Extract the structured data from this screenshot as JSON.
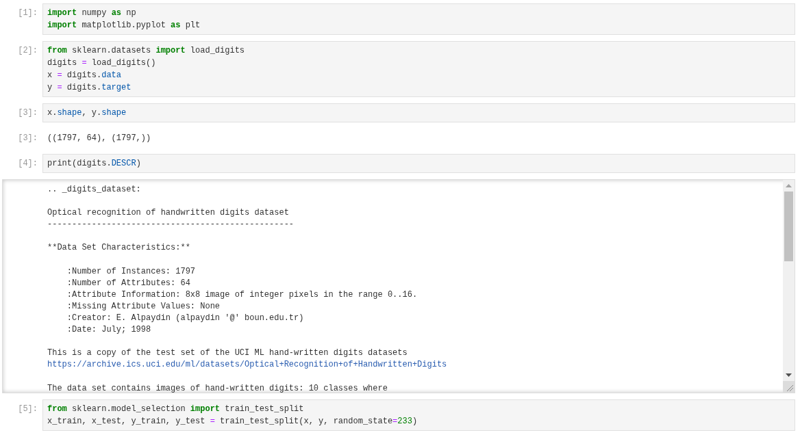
{
  "cells": [
    {
      "kind": "code",
      "prompt": "[1]:",
      "lines": [
        [
          {
            "kind": "kw",
            "text": "import"
          },
          {
            "kind": "plain",
            "text": " numpy "
          },
          {
            "kind": "kw",
            "text": "as"
          },
          {
            "kind": "plain",
            "text": " np"
          }
        ],
        [
          {
            "kind": "kw",
            "text": "import"
          },
          {
            "kind": "plain",
            "text": " matplotlib.pyplot "
          },
          {
            "kind": "kw",
            "text": "as"
          },
          {
            "kind": "plain",
            "text": " plt"
          }
        ]
      ]
    },
    {
      "kind": "code",
      "prompt": "[2]:",
      "lines": [
        [
          {
            "kind": "kw",
            "text": "from"
          },
          {
            "kind": "plain",
            "text": " sklearn.datasets "
          },
          {
            "kind": "kw",
            "text": "import"
          },
          {
            "kind": "plain",
            "text": " load_digits"
          }
        ],
        [
          {
            "kind": "plain",
            "text": "digits "
          },
          {
            "kind": "op",
            "text": "="
          },
          {
            "kind": "plain",
            "text": " load_digits()"
          }
        ],
        [
          {
            "kind": "plain",
            "text": "x "
          },
          {
            "kind": "op",
            "text": "="
          },
          {
            "kind": "plain",
            "text": " digits."
          },
          {
            "kind": "attr",
            "text": "data"
          }
        ],
        [
          {
            "kind": "plain",
            "text": "y "
          },
          {
            "kind": "op",
            "text": "="
          },
          {
            "kind": "plain",
            "text": " digits."
          },
          {
            "kind": "attr",
            "text": "target"
          }
        ]
      ]
    },
    {
      "kind": "code",
      "prompt": "[3]:",
      "lines": [
        [
          {
            "kind": "plain",
            "text": "x."
          },
          {
            "kind": "attr",
            "text": "shape"
          },
          {
            "kind": "plain",
            "text": ", y."
          },
          {
            "kind": "attr",
            "text": "shape"
          }
        ]
      ]
    },
    {
      "kind": "result",
      "prompt": "[3]:",
      "text": "((1797, 64), (1797,))"
    },
    {
      "kind": "code",
      "prompt": "[4]:",
      "lines": [
        [
          {
            "kind": "plain",
            "text": "print(digits."
          },
          {
            "kind": "attr",
            "text": "DESCR"
          },
          {
            "kind": "plain",
            "text": ")"
          }
        ]
      ]
    },
    {
      "kind": "stream",
      "lines": [
        {
          "kind": "text",
          "text": ".. _digits_dataset:"
        },
        {
          "kind": "blank"
        },
        {
          "kind": "text",
          "text": "Optical recognition of handwritten digits dataset"
        },
        {
          "kind": "text",
          "text": "--------------------------------------------------"
        },
        {
          "kind": "blank"
        },
        {
          "kind": "text",
          "text": "**Data Set Characteristics:**"
        },
        {
          "kind": "blank"
        },
        {
          "kind": "text",
          "text": "    :Number of Instances: 1797"
        },
        {
          "kind": "text",
          "text": "    :Number of Attributes: 64"
        },
        {
          "kind": "text",
          "text": "    :Attribute Information: 8x8 image of integer pixels in the range 0..16."
        },
        {
          "kind": "text",
          "text": "    :Missing Attribute Values: None"
        },
        {
          "kind": "text",
          "text": "    :Creator: E. Alpaydin (alpaydin '@' boun.edu.tr)"
        },
        {
          "kind": "text",
          "text": "    :Date: July; 1998"
        },
        {
          "kind": "blank"
        },
        {
          "kind": "text",
          "text": "This is a copy of the test set of the UCI ML hand-written digits datasets"
        },
        {
          "kind": "link",
          "text": "https://archive.ics.uci.edu/ml/datasets/Optical+Recognition+of+Handwritten+Digits"
        },
        {
          "kind": "blank"
        },
        {
          "kind": "text",
          "text": "The data set contains images of hand-written digits: 10 classes where"
        }
      ]
    },
    {
      "kind": "code",
      "prompt": "[5]:",
      "lines": [
        [
          {
            "kind": "kw",
            "text": "from"
          },
          {
            "kind": "plain",
            "text": " sklearn.model_selection "
          },
          {
            "kind": "kw",
            "text": "import"
          },
          {
            "kind": "plain",
            "text": " train_test_split"
          }
        ],
        [
          {
            "kind": "plain",
            "text": "x_train, x_test, y_train, y_test "
          },
          {
            "kind": "op",
            "text": "="
          },
          {
            "kind": "plain",
            "text": " train_test_split(x, y, random_state"
          },
          {
            "kind": "op",
            "text": "="
          },
          {
            "kind": "num",
            "text": "233"
          },
          {
            "kind": "plain",
            "text": ")"
          }
        ]
      ]
    }
  ]
}
